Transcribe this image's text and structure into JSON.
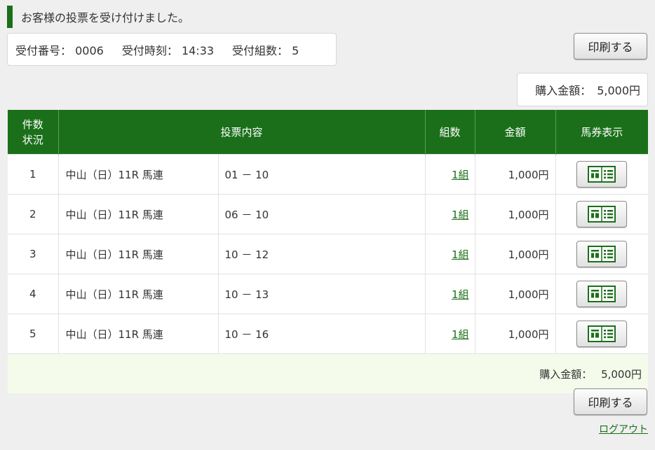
{
  "notice": {
    "message": "お客様の投票を受け付けました。"
  },
  "receipt": {
    "number_label": "受付番号：",
    "number_value": "0006",
    "time_label": "受付時刻：",
    "time_value": "14:33",
    "count_label": "受付組数：",
    "count_value": "5"
  },
  "buttons": {
    "print_label": "印刷する"
  },
  "totals": {
    "label": "購入金額：",
    "value": "5,000円"
  },
  "table": {
    "headers": {
      "count_line1": "件数",
      "count_line2": "状況",
      "content": "投票内容",
      "sets": "組数",
      "amount": "金額",
      "ticket": "馬券表示"
    },
    "rows": [
      {
        "num": "1",
        "race": "中山（日）11R 馬連",
        "combo": "01 － 10",
        "sets": "1組",
        "amount": "1,000円"
      },
      {
        "num": "2",
        "race": "中山（日）11R 馬連",
        "combo": "06 － 10",
        "sets": "1組",
        "amount": "1,000円"
      },
      {
        "num": "3",
        "race": "中山（日）11R 馬連",
        "combo": "10 － 12",
        "sets": "1組",
        "amount": "1,000円"
      },
      {
        "num": "4",
        "race": "中山（日）11R 馬連",
        "combo": "10 － 13",
        "sets": "1組",
        "amount": "1,000円"
      },
      {
        "num": "5",
        "race": "中山（日）11R 馬連",
        "combo": "10 － 16",
        "sets": "1組",
        "amount": "1,000円"
      }
    ]
  },
  "logout_label": "ログアウト",
  "colors": {
    "accent": "#1b6f1a",
    "total_row_bg": "#f4fbea"
  },
  "icons": {
    "ticket": "ticket-icon"
  }
}
